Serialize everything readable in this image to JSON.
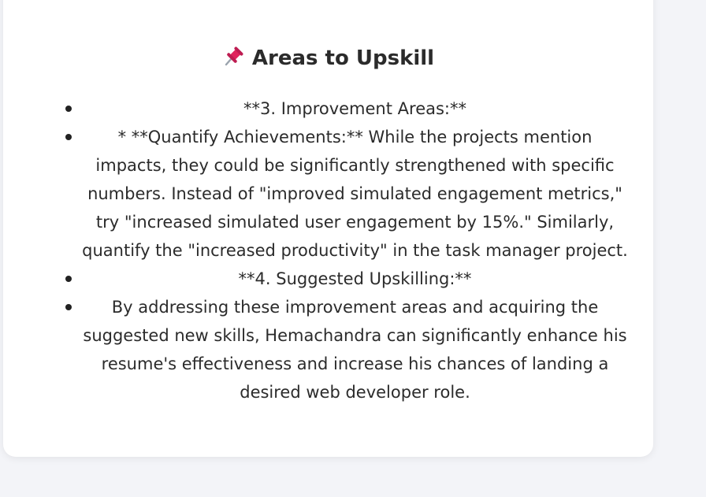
{
  "section": {
    "icon": "pushpin-icon",
    "title": "Areas to Upskill"
  },
  "items": [
    "**3. Improvement Areas:**",
    "* **Quantify Achievements:** While the projects mention impacts, they could be significantly strengthened with specific numbers. Instead of \"improved simulated engagement metrics,\" try \"increased simulated user engagement by 15%.\" Similarly, quantify the \"increased productivity\" in the task manager project.",
    "**4. Suggested Upskilling:**",
    "By addressing these improvement areas and acquiring the suggested new skills, Hemachandra can significantly enhance his resume's effectiveness and increase his chances of landing a desired web developer role."
  ],
  "colors": {
    "page_bg": "#f3f4f8",
    "card_bg": "#ffffff",
    "text": "#2b2b2b",
    "pin": "#e0245e"
  }
}
